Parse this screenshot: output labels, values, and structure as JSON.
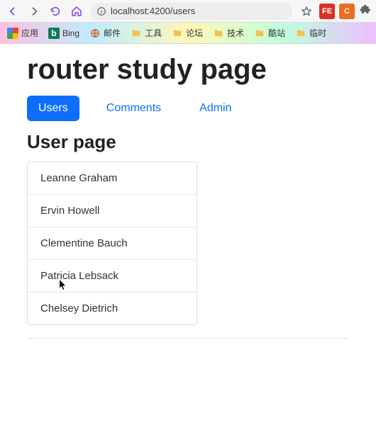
{
  "browser": {
    "url_text": "localhost:4200/users",
    "ext1_label": "FE",
    "ext2_label": "C"
  },
  "bookmarks": {
    "apps": "应用",
    "bing_icon": "b",
    "bing": "Bing",
    "mail": "邮件",
    "tools": "工具",
    "forum": "论坛",
    "tech": "技术",
    "cool": "酷站",
    "temp": "临时"
  },
  "page": {
    "title": "router study page",
    "subtitle": "User page"
  },
  "tabs": [
    {
      "label": "Users",
      "active": true
    },
    {
      "label": "Comments",
      "active": false
    },
    {
      "label": "Admin",
      "active": false
    }
  ],
  "users": [
    {
      "name": "Leanne Graham"
    },
    {
      "name": "Ervin Howell"
    },
    {
      "name": "Clementine Bauch"
    },
    {
      "name": "Patricia Lebsack"
    },
    {
      "name": "Chelsey Dietrich"
    }
  ]
}
